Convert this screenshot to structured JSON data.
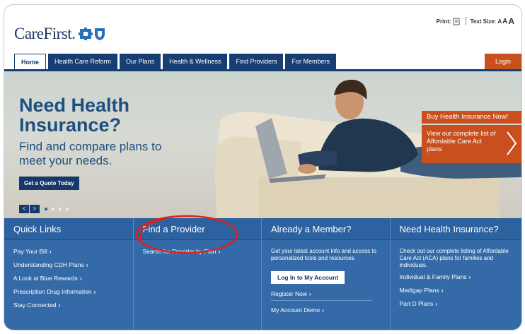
{
  "brand": {
    "logo_text": "CareFirst."
  },
  "utility": {
    "print_label": "Print:",
    "text_size_label": "Text Size:",
    "size_small": "A",
    "size_medium": "A",
    "size_large": "A"
  },
  "nav": {
    "tabs": [
      {
        "label": "Home"
      },
      {
        "label": "Health Care Reform"
      },
      {
        "label": "Our Plans"
      },
      {
        "label": "Health & Wellness"
      },
      {
        "label": "Find Providers"
      },
      {
        "label": "For Members"
      }
    ],
    "login_label": "Login"
  },
  "hero": {
    "headline": "Need Health Insurance?",
    "subhead": "Find and compare plans to meet your needs.",
    "cta_label": "Get a Quote Today",
    "prev_label": "<",
    "next_label": ">"
  },
  "promo": {
    "title": "Buy Health Insurance Now!",
    "body": "View our complete list of Affordable Care Act plans"
  },
  "panels": {
    "quick_links": {
      "title": "Quick Links",
      "items": [
        "Pay Your Bill",
        "Understanding CDH Plans",
        "A Look at Blue Rewards",
        "Prescription Drug Information",
        "Stay Connected"
      ]
    },
    "find_provider": {
      "title": "Find a Provider",
      "items": [
        "Search for Provider by Plan"
      ]
    },
    "member": {
      "title": "Already a Member?",
      "text": "Get your latest account info and access to personalized tools and resources.",
      "button_label": "Log In to My Account",
      "register_label": "Register Now",
      "demo_label": "My Account Demo"
    },
    "need_insurance": {
      "title": "Need Health Insurance?",
      "text": "Check out our complete listing of Affordable Care Act (ACA) plans for families and individuals.",
      "items": [
        "Individual & Family Plans",
        "Medigap Plans",
        "Part D Plans"
      ]
    }
  },
  "colors": {
    "navy": "#173e72",
    "orange": "#c9501e",
    "panel_blue": "#336aa7",
    "annotation_red": "#e0201b"
  }
}
